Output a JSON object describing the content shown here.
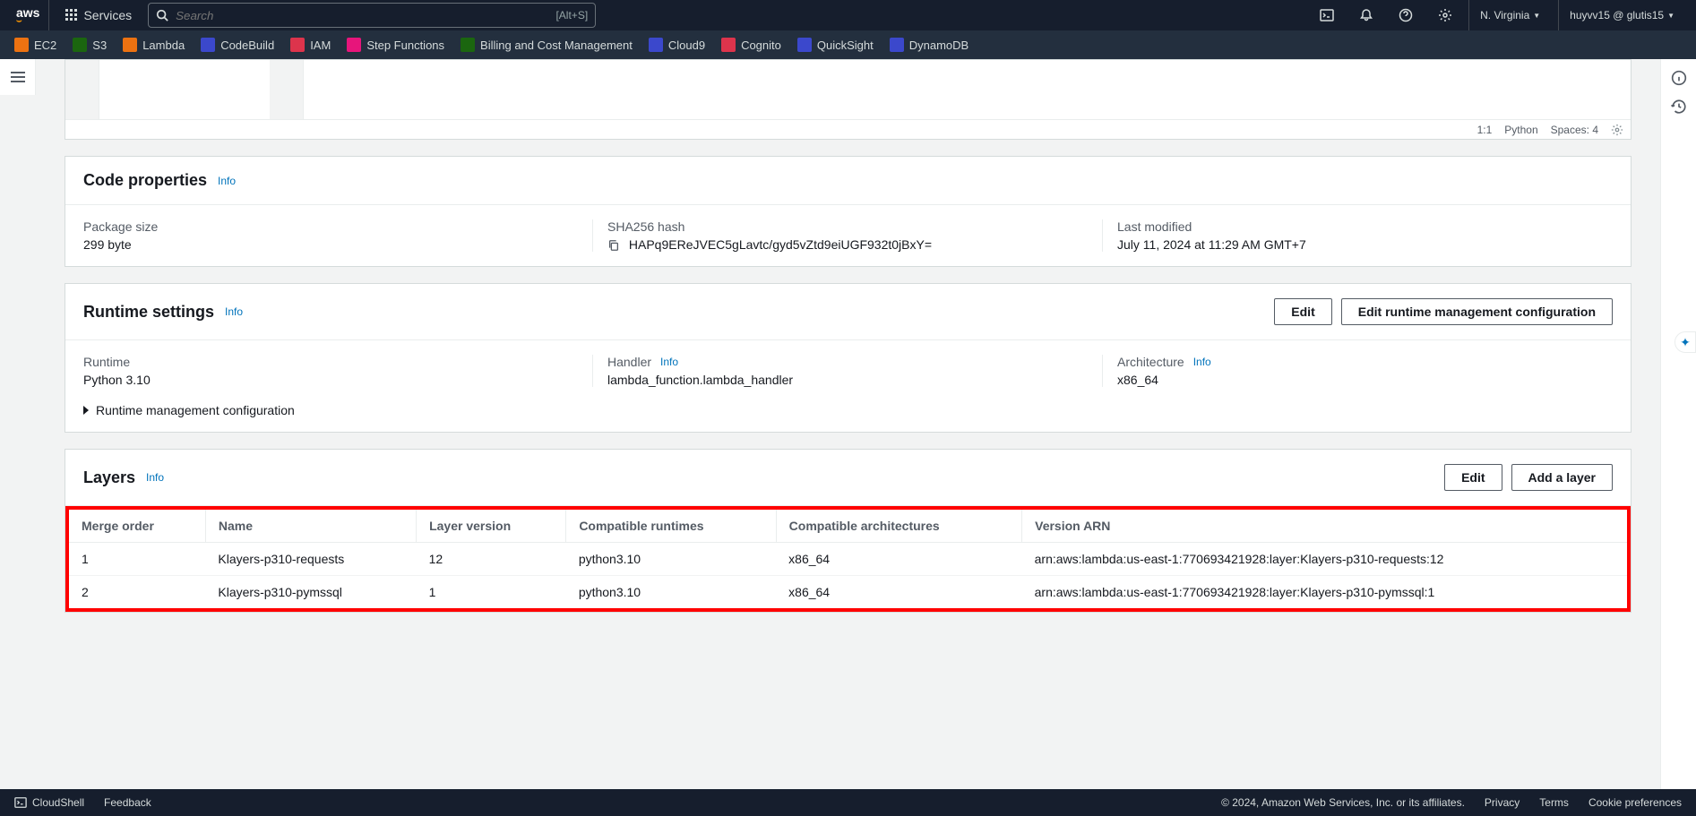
{
  "nav": {
    "services_label": "Services",
    "search_placeholder": "Search",
    "search_hint": "[Alt+S]",
    "region": "N. Virginia",
    "account": "huyvv15 @ glutis15",
    "shortcuts": [
      {
        "label": "EC2",
        "color": "#ec7211"
      },
      {
        "label": "S3",
        "color": "#1b660f"
      },
      {
        "label": "Lambda",
        "color": "#ec7211"
      },
      {
        "label": "CodeBuild",
        "color": "#3b48cc"
      },
      {
        "label": "IAM",
        "color": "#dd344c"
      },
      {
        "label": "Step Functions",
        "color": "#e7157b"
      },
      {
        "label": "Billing and Cost Management",
        "color": "#1b660f"
      },
      {
        "label": "Cloud9",
        "color": "#3b48cc"
      },
      {
        "label": "Cognito",
        "color": "#dd344c"
      },
      {
        "label": "QuickSight",
        "color": "#3b48cc"
      },
      {
        "label": "DynamoDB",
        "color": "#3b48cc"
      }
    ]
  },
  "editor": {
    "cursor": "1:1",
    "language": "Python",
    "spaces": "Spaces: 4"
  },
  "code_properties": {
    "title": "Code properties",
    "info": "Info",
    "package_size_label": "Package size",
    "package_size": "299 byte",
    "sha_label": "SHA256 hash",
    "sha": "HAPq9EReJVEC5gLavtc/gyd5vZtd9eiUGF932t0jBxY=",
    "modified_label": "Last modified",
    "modified": "July 11, 2024 at 11:29 AM GMT+7"
  },
  "runtime": {
    "title": "Runtime settings",
    "info": "Info",
    "edit_btn": "Edit",
    "edit_mgmt_btn": "Edit runtime management configuration",
    "runtime_label": "Runtime",
    "runtime_value": "Python 3.10",
    "handler_label": "Handler",
    "handler_info": "Info",
    "handler_value": "lambda_function.lambda_handler",
    "arch_label": "Architecture",
    "arch_info": "Info",
    "arch_value": "x86_64",
    "mgmt_expand": "Runtime management configuration"
  },
  "layers": {
    "title": "Layers",
    "info": "Info",
    "edit_btn": "Edit",
    "add_btn": "Add a layer",
    "cols": {
      "merge_order": "Merge order",
      "name": "Name",
      "version": "Layer version",
      "runtimes": "Compatible runtimes",
      "arch": "Compatible architectures",
      "arn": "Version ARN"
    },
    "rows": [
      {
        "order": "1",
        "name": "Klayers-p310-requests",
        "version": "12",
        "runtimes": "python3.10",
        "arch": "x86_64",
        "arn": "arn:aws:lambda:us-east-1:770693421928:layer:Klayers-p310-requests:12"
      },
      {
        "order": "2",
        "name": "Klayers-p310-pymssql",
        "version": "1",
        "runtimes": "python3.10",
        "arch": "x86_64",
        "arn": "arn:aws:lambda:us-east-1:770693421928:layer:Klayers-p310-pymssql:1"
      }
    ]
  },
  "footer": {
    "cloudshell": "CloudShell",
    "feedback": "Feedback",
    "copyright": "© 2024, Amazon Web Services, Inc. or its affiliates.",
    "privacy": "Privacy",
    "terms": "Terms",
    "cookies": "Cookie preferences"
  }
}
